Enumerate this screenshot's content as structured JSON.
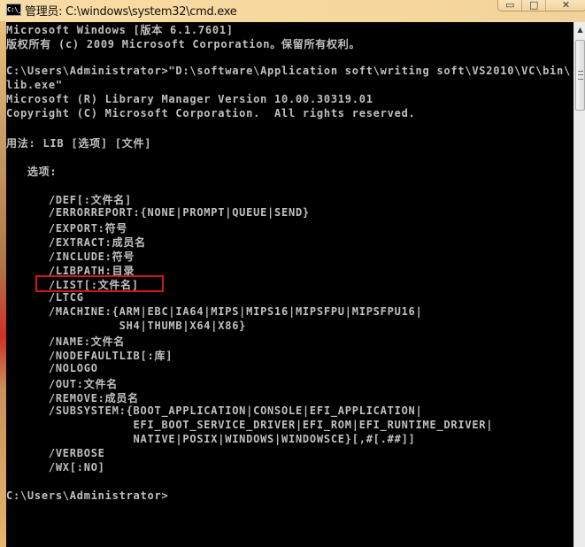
{
  "window": {
    "title": "管理员: C:\\windows\\system32\\cmd.exe",
    "icon": "cmd-icon",
    "icon_text": "C:\\_",
    "controls": {
      "minimize": "▭",
      "maximize": "□",
      "close": "✕"
    }
  },
  "console": {
    "lines": [
      "Microsoft Windows [版本 6.1.7601]",
      "版权所有 (c) 2009 Microsoft Corporation。保留所有权利。",
      "",
      "C:\\Users\\Administrator>\"D:\\software\\Application soft\\writing soft\\VS2010\\VC\\bin\\",
      "lib.exe\"",
      "Microsoft (R) Library Manager Version 10.00.30319.01",
      "Copyright (C) Microsoft Corporation.  All rights reserved.",
      "",
      "用法: LIB [选项] [文件]",
      "",
      "   选项:",
      "",
      "      /DEF[:文件名]",
      "      /ERRORREPORT:{NONE|PROMPT|QUEUE|SEND}",
      "      /EXPORT:符号",
      "      /EXTRACT:成员名",
      "      /INCLUDE:符号",
      "      /LIBPATH:目录",
      "      /LIST[:文件名]",
      "      /LTCG",
      "      /MACHINE:{ARM|EBC|IA64|MIPS|MIPS16|MIPSFPU|MIPSFPU16|",
      "                SH4|THUMB|X64|X86}",
      "      /NAME:文件名",
      "      /NODEFAULTLIB[:库]",
      "      /NOLOGO",
      "      /OUT:文件名",
      "      /REMOVE:成员名",
      "      /SUBSYSTEM:{BOOT_APPLICATION|CONSOLE|EFI_APPLICATION|",
      "                  EFI_BOOT_SERVICE_DRIVER|EFI_ROM|EFI_RUNTIME_DRIVER|",
      "                  NATIVE|POSIX|WINDOWS|WINDOWSCE}[,#[.##]]",
      "      /VERBOSE",
      "      /WX[:NO]",
      "",
      "C:\\Users\\Administrator>"
    ],
    "highlighted_line_index": 18,
    "highlight_color": "#d01818",
    "text_color": "#c0c0c0",
    "background_color": "#000000"
  },
  "scrollbar": {
    "up_arrow": "▲"
  }
}
